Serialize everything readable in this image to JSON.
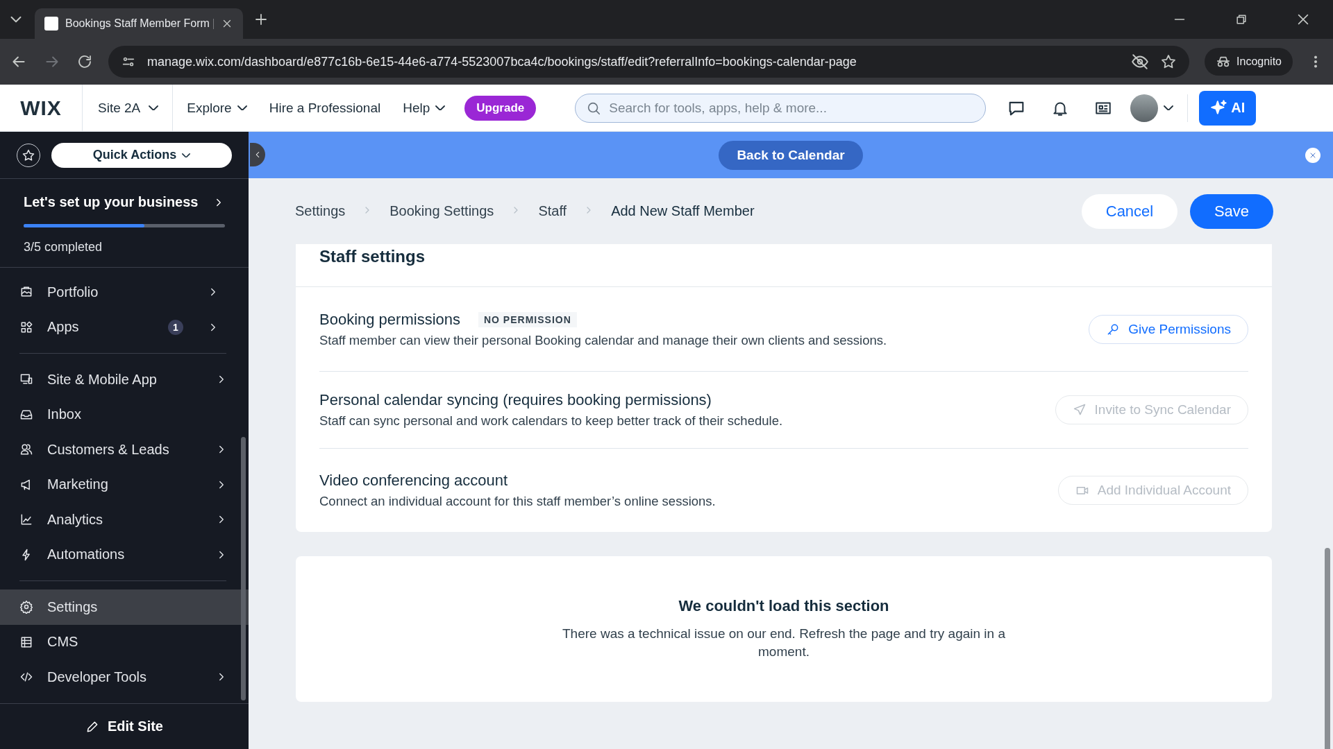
{
  "browser": {
    "tab": {
      "title": "Bookings Staff Member Form |",
      "selected": true
    },
    "url": "manage.wix.com/dashboard/e877c16b-6e15-44e6-a774-5523007bca4c/bookings/staff/edit?referralInfo=bookings-calendar-page",
    "profile": "Incognito"
  },
  "topbar": {
    "logo": "WIX",
    "site": "Site 2A",
    "menu": [
      {
        "label": "Explore",
        "dropdown": true
      },
      {
        "label": "Hire a Professional",
        "dropdown": false
      },
      {
        "label": "Help",
        "dropdown": true
      }
    ],
    "upgrade": "Upgrade",
    "search": {
      "placeholder": "Search for tools, apps, help & more..."
    },
    "ai": "AI"
  },
  "banner": {
    "button": "Back to Calendar"
  },
  "sidebar": {
    "quick_actions": "Quick Actions",
    "setup": {
      "title": "Let's set up your business",
      "level": 0.6,
      "progress": "3/5 completed"
    },
    "sections": [
      {
        "items": [
          {
            "label": "Portfolio",
            "arrow": true,
            "selected": false
          },
          {
            "label": "Apps",
            "badge": "1",
            "arrow": true,
            "selected": false
          }
        ]
      },
      {
        "items": [
          {
            "label": "Site & Mobile App",
            "arrow": true,
            "selected": false
          },
          {
            "label": "Inbox",
            "arrow": false,
            "selected": false
          },
          {
            "label": "Customers & Leads",
            "arrow": true,
            "selected": false
          },
          {
            "label": "Marketing",
            "arrow": true,
            "selected": false
          },
          {
            "label": "Analytics",
            "arrow": true,
            "selected": false
          },
          {
            "label": "Automations",
            "arrow": true,
            "selected": false
          }
        ]
      },
      {
        "items": [
          {
            "label": "Settings",
            "arrow": false,
            "selected": true
          },
          {
            "label": "CMS",
            "arrow": false,
            "selected": false
          },
          {
            "label": "Developer Tools",
            "arrow": true,
            "selected": false
          }
        ]
      }
    ],
    "edit_site": "Edit Site"
  },
  "breadcrumbs": [
    {
      "label": "Settings",
      "current": false
    },
    {
      "label": "Booking Settings",
      "current": false
    },
    {
      "label": "Staff",
      "current": false
    },
    {
      "label": "Add New Staff Member",
      "current": true
    }
  ],
  "actions": {
    "cancel": "Cancel",
    "save": "Save"
  },
  "staff_settings": {
    "title": "Staff settings",
    "rows": [
      {
        "title": "Booking permissions",
        "badge": "NO PERMISSION",
        "description": "Staff member can view their personal Booking calendar and manage their own clients and sessions.",
        "action": {
          "label": "Give Permissions",
          "disabled": false
        }
      },
      {
        "title": "Personal calendar syncing (requires booking permissions)",
        "description": "Staff can sync personal and work calendars to keep better track of their schedule.",
        "action": {
          "label": "Invite to Sync Calendar",
          "disabled": true
        }
      },
      {
        "title": "Video conferencing account",
        "description": "Connect an individual account for this staff member’s online sessions.",
        "action": {
          "label": "Add Individual Account",
          "disabled": true
        }
      }
    ]
  },
  "error": {
    "title": "We couldn't load this section",
    "message": "There was a technical issue on our end. Refresh the page and try again in a moment."
  }
}
